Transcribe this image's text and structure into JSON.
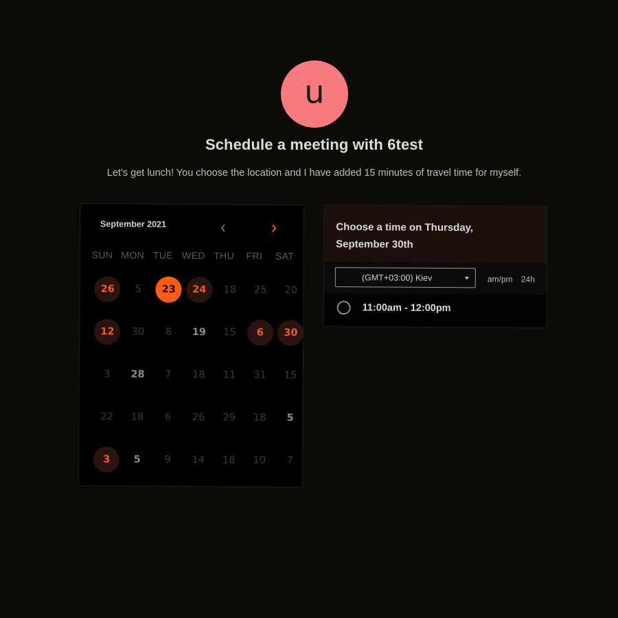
{
  "host": {
    "avatar_letter": "u",
    "avatar_color": "#f77b7e"
  },
  "title": "Schedule a meeting with 6test",
  "subtitle": "Let’s get lunch! You choose the location and I have added 15 minutes of travel time for myself.",
  "calendar": {
    "month_label": "September 2021",
    "prev_icon": "chevron-left-icon",
    "next_icon": "chevron-right-icon",
    "weekdays": [
      "SUN",
      "MON",
      "TUE",
      "WED",
      "THU",
      "FRI",
      "SAT"
    ],
    "weeks": [
      [
        {
          "d": "26",
          "s": "avail"
        },
        {
          "d": "5",
          "s": "muted"
        },
        {
          "d": "23",
          "s": "sel"
        },
        {
          "d": "24",
          "s": "avail"
        },
        {
          "d": "18",
          "s": "muted"
        },
        {
          "d": "25",
          "s": "muted"
        },
        {
          "d": "20",
          "s": "muted"
        }
      ],
      [
        {
          "d": "12",
          "s": "avail"
        },
        {
          "d": "30",
          "s": "muted"
        },
        {
          "d": "8",
          "s": "muted"
        },
        {
          "d": "19",
          "s": "normal"
        },
        {
          "d": "15",
          "s": "muted"
        },
        {
          "d": "6",
          "s": "avail"
        },
        {
          "d": "30",
          "s": "avail"
        }
      ],
      [
        {
          "d": "3",
          "s": "muted"
        },
        {
          "d": "28",
          "s": "normal"
        },
        {
          "d": "7",
          "s": "muted"
        },
        {
          "d": "18",
          "s": "muted"
        },
        {
          "d": "11",
          "s": "muted"
        },
        {
          "d": "31",
          "s": "muted"
        },
        {
          "d": "15",
          "s": "muted"
        }
      ],
      [
        {
          "d": "22",
          "s": "muted"
        },
        {
          "d": "18",
          "s": "muted"
        },
        {
          "d": "6",
          "s": "muted"
        },
        {
          "d": "26",
          "s": "muted"
        },
        {
          "d": "29",
          "s": "muted"
        },
        {
          "d": "18",
          "s": "muted"
        },
        {
          "d": "5",
          "s": "normal"
        }
      ],
      [
        {
          "d": "3",
          "s": "avail"
        },
        {
          "d": "5",
          "s": "normal"
        },
        {
          "d": "9",
          "s": "muted"
        },
        {
          "d": "14",
          "s": "muted"
        },
        {
          "d": "18",
          "s": "muted"
        },
        {
          "d": "10",
          "s": "muted"
        },
        {
          "d": "7",
          "s": "muted"
        }
      ]
    ],
    "accent_color": "#ff5b14"
  },
  "time_panel": {
    "heading": "Choose a time on Thursday, September 30th",
    "timezone": "(GMT+03:00) Kiev",
    "format_ampm": "am/pm",
    "format_24h": "24h",
    "slots": [
      {
        "label": "11:00am - 12:00pm"
      }
    ]
  }
}
